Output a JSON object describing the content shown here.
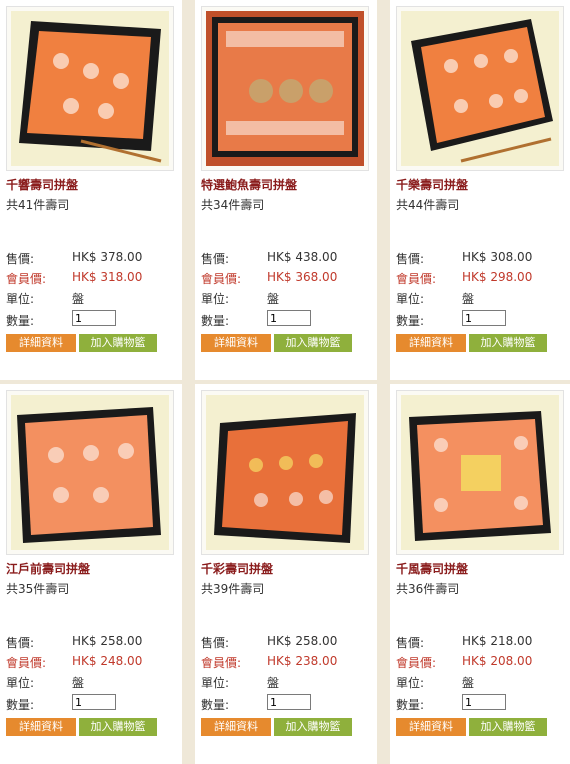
{
  "labels": {
    "price": "售價:",
    "member_price": "會員價:",
    "unit": "單位:",
    "quantity": "數量:",
    "details_button": "詳細資料",
    "cart_button": "加入購物籃"
  },
  "colors": {
    "product_name": "#8a1c1c",
    "member_price": "#c0392b",
    "details_button": "#e68a2e",
    "cart_button": "#8fb03c"
  },
  "products": [
    {
      "name": "千響壽司拼盤",
      "count": "共41件壽司",
      "price": "HK$ 378.00",
      "member_price": "HK$ 318.00",
      "unit": "盤",
      "quantity": "1"
    },
    {
      "name": "特選鮑魚壽司拼盤",
      "count": "共34件壽司",
      "price": "HK$ 438.00",
      "member_price": "HK$ 368.00",
      "unit": "盤",
      "quantity": "1"
    },
    {
      "name": "千樂壽司拼盤",
      "count": "共44件壽司",
      "price": "HK$ 308.00",
      "member_price": "HK$ 298.00",
      "unit": "盤",
      "quantity": "1"
    },
    {
      "name": "江戶前壽司拼盤",
      "count": "共35件壽司",
      "price": "HK$ 258.00",
      "member_price": "HK$ 248.00",
      "unit": "盤",
      "quantity": "1"
    },
    {
      "name": "千彩壽司拼盤",
      "count": "共39件壽司",
      "price": "HK$ 258.00",
      "member_price": "HK$ 238.00",
      "unit": "盤",
      "quantity": "1"
    },
    {
      "name": "千風壽司拼盤",
      "count": "共36件壽司",
      "price": "HK$ 218.00",
      "member_price": "HK$ 208.00",
      "unit": "盤",
      "quantity": "1"
    }
  ]
}
